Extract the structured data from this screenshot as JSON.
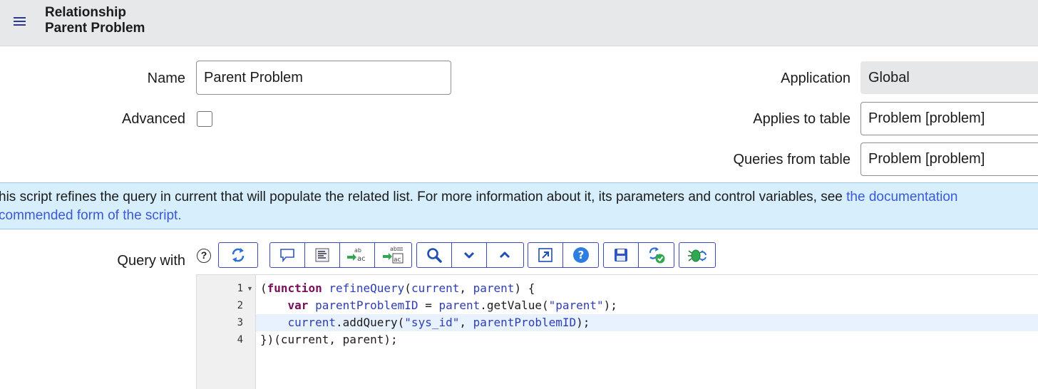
{
  "header": {
    "menu_icon": "hamburger-menu-icon",
    "title_line1": "Relationship",
    "title_line2": "Parent Problem"
  },
  "form": {
    "name_label": "Name",
    "name_value": "Parent Problem",
    "advanced_label": "Advanced",
    "advanced_checked": false,
    "application_label": "Application",
    "application_value": "Global",
    "applies_to_label": "Applies to table",
    "applies_to_value": "Problem [problem]",
    "queries_from_label": "Queries from table",
    "queries_from_value": "Problem [problem]"
  },
  "banner": {
    "line1_text": "his script refines the query in current that will populate the related list. For more information about it, its parameters and control variables, see ",
    "line1_link": "the documentation",
    "line2_link": "commended form of the script."
  },
  "script": {
    "label": "Query with",
    "help_icon": "question-circle-icon",
    "help_glyph": "?",
    "toolbar_icons": [
      "toggle-syntax-editor-icon",
      "comment-icon",
      "format-code-icon",
      "replace-icon",
      "replace-all-icon",
      "search-icon",
      "next-match-icon",
      "previous-match-icon",
      "fullscreen-icon",
      "help-icon",
      "save-icon",
      "validate-script-icon",
      "debug-script-icon"
    ],
    "line_numbers": [
      "1",
      "2",
      "3",
      "4"
    ],
    "active_line": 3,
    "code": {
      "l1": [
        {
          "t": "(",
          "c": ""
        },
        {
          "t": "function",
          "c": "kw"
        },
        {
          "t": " refineQuery",
          "c": "fn"
        },
        {
          "t": "(",
          "c": ""
        },
        {
          "t": "current",
          "c": "fn"
        },
        {
          "t": ", ",
          "c": ""
        },
        {
          "t": "parent",
          "c": "fn"
        },
        {
          "t": ") {",
          "c": ""
        }
      ],
      "l2": [
        {
          "t": "    ",
          "c": ""
        },
        {
          "t": "var",
          "c": "kw"
        },
        {
          "t": " parentProblemID",
          "c": "fn"
        },
        {
          "t": " = ",
          "c": ""
        },
        {
          "t": "parent",
          "c": "fn"
        },
        {
          "t": ".getValue(",
          "c": ""
        },
        {
          "t": "\"parent\"",
          "c": "str"
        },
        {
          "t": ");",
          "c": ""
        }
      ],
      "l3": [
        {
          "t": "    ",
          "c": ""
        },
        {
          "t": "current",
          "c": "fn"
        },
        {
          "t": ".addQuery(",
          "c": ""
        },
        {
          "t": "\"sys_id\"",
          "c": "str"
        },
        {
          "t": ", ",
          "c": ""
        },
        {
          "t": "parentProblemID",
          "c": "fn"
        },
        {
          "t": ");",
          "c": ""
        }
      ],
      "l4": [
        {
          "t": "})(current, parent);",
          "c": ""
        }
      ]
    }
  }
}
